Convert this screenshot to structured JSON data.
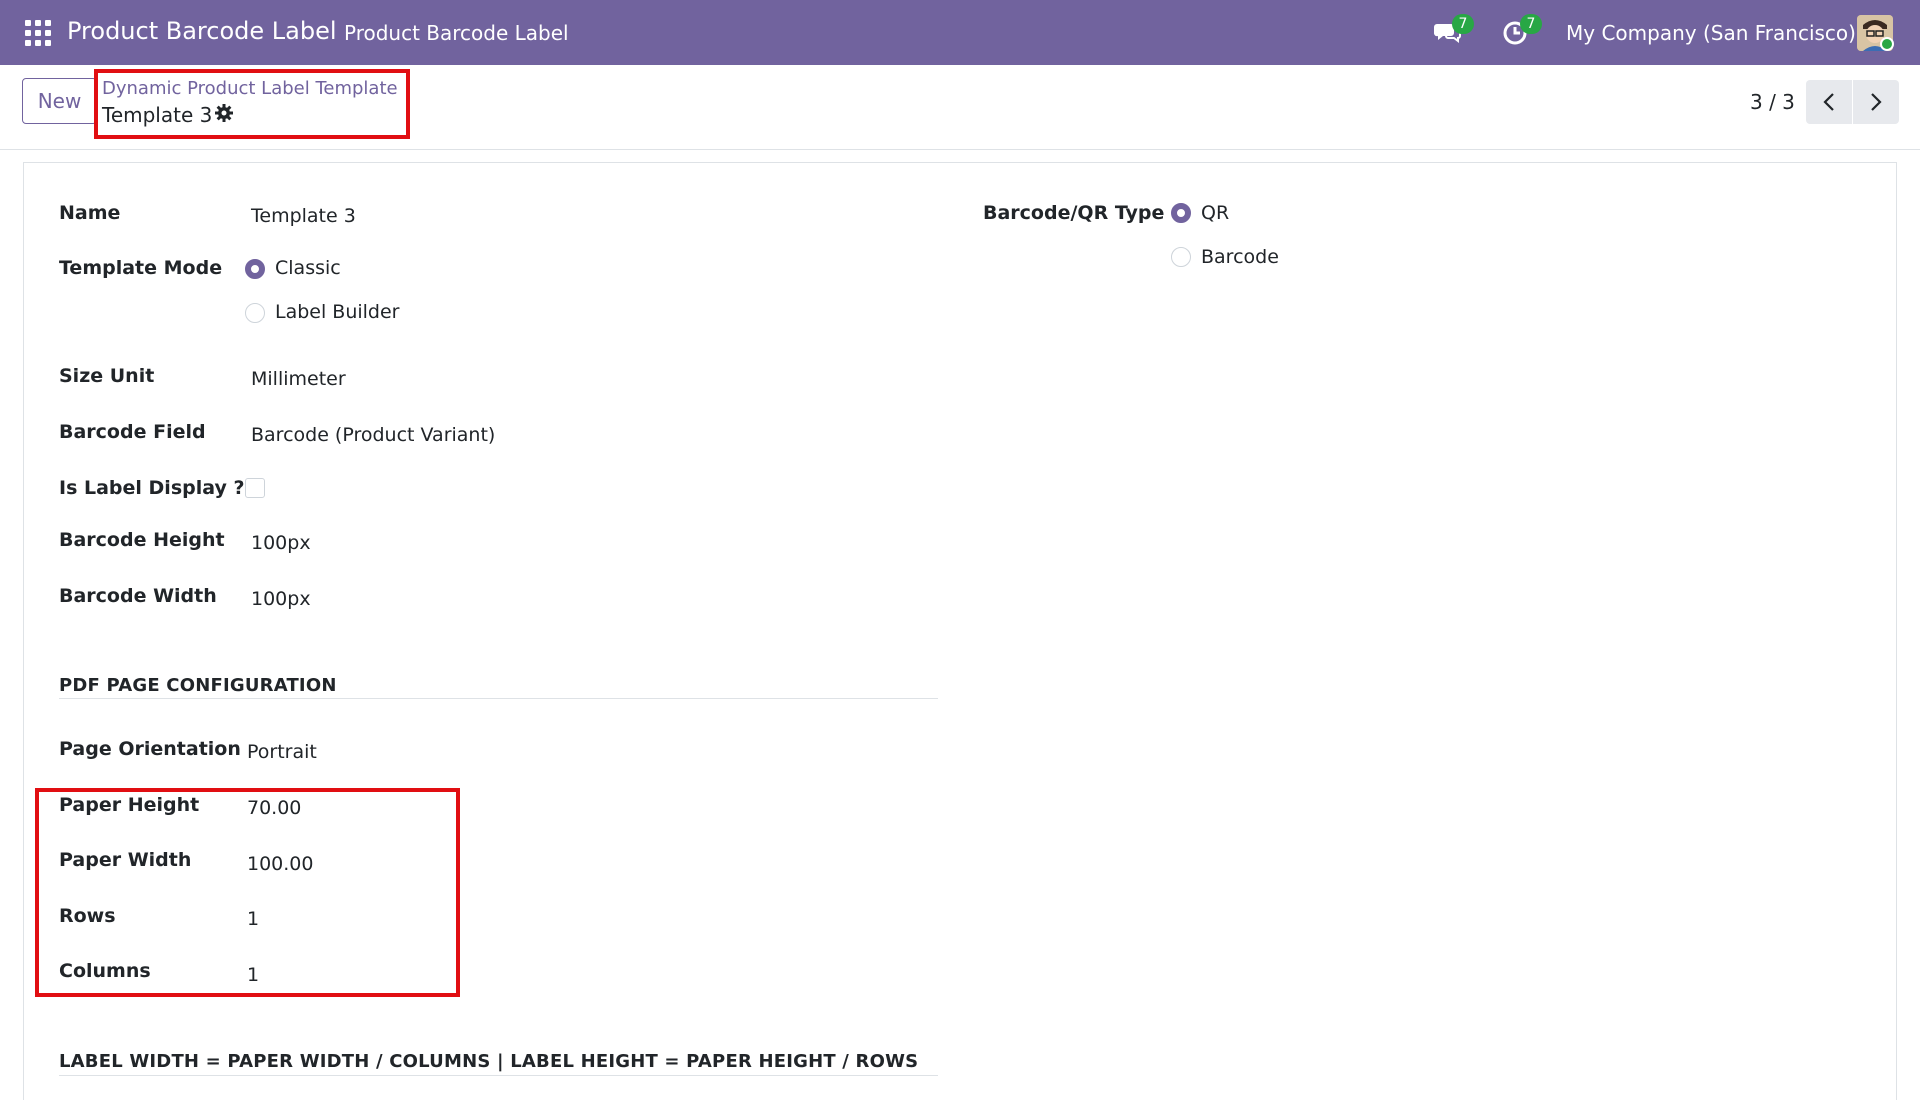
{
  "navbar": {
    "app_name": "Product Barcode Label",
    "menu_item": "Product Barcode Label",
    "messages_count": "7",
    "activities_count": "7",
    "company": "My Company (San Francisco)"
  },
  "control": {
    "new_label": "New",
    "breadcrumb_parent": "Dynamic Product Label Template",
    "breadcrumb_current": "Template 3",
    "pager": "3 / 3"
  },
  "form": {
    "name": {
      "label": "Name",
      "value": "Template 3"
    },
    "template_mode": {
      "label": "Template Mode",
      "options": [
        "Classic",
        "Label Builder"
      ],
      "selected": "Classic"
    },
    "size_unit": {
      "label": "Size Unit",
      "value": "Millimeter"
    },
    "barcode_field": {
      "label": "Barcode Field",
      "value": "Barcode (Product Variant)"
    },
    "is_label_display": {
      "label": "Is Label Display ?",
      "checked": false
    },
    "barcode_height": {
      "label": "Barcode Height",
      "value": "100px"
    },
    "barcode_width": {
      "label": "Barcode Width",
      "value": "100px"
    },
    "barcode_type": {
      "label": "Barcode/QR Type",
      "options": [
        "QR",
        "Barcode"
      ],
      "selected": "QR"
    },
    "pdf_section": "PDF PAGE CONFIGURATION",
    "page_orientation": {
      "label": "Page Orientation",
      "value": "Portrait"
    },
    "paper_height": {
      "label": "Paper Height",
      "value": "70.00"
    },
    "paper_width": {
      "label": "Paper Width",
      "value": "100.00"
    },
    "rows": {
      "label": "Rows",
      "value": "1"
    },
    "columns": {
      "label": "Columns",
      "value": "1"
    },
    "formula_section": "LABEL WIDTH = PAPER WIDTH / COLUMNS | LABEL HEIGHT = PAPER HEIGHT / ROWS"
  },
  "colors": {
    "brand": "#71639e",
    "highlight": "#e10e12",
    "badge": "#28a745"
  }
}
